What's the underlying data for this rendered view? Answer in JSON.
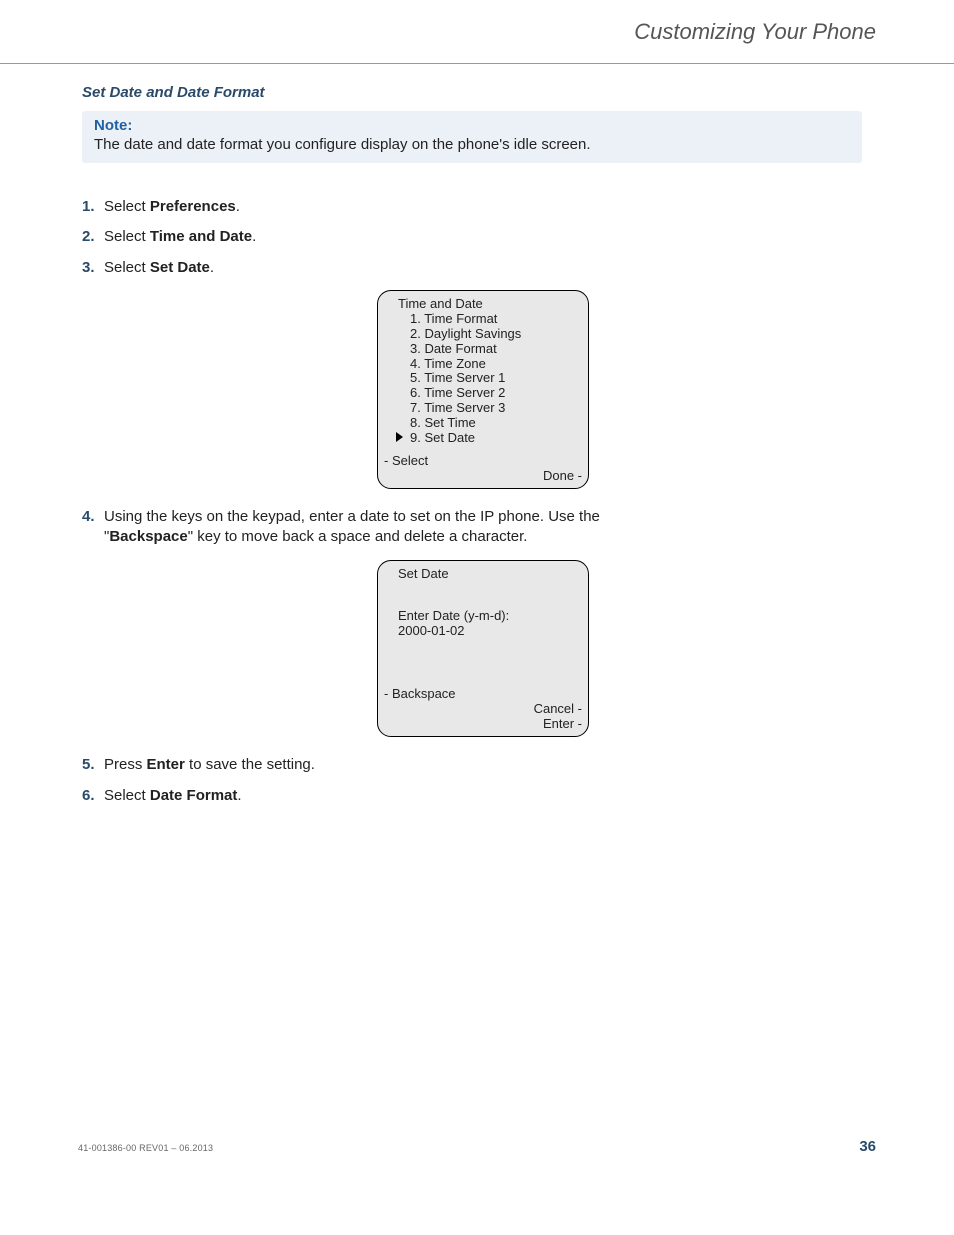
{
  "header": {
    "chapter": "Customizing Your Phone"
  },
  "section": {
    "title": "Set Date and Date Format"
  },
  "note": {
    "label": "Note:",
    "body": "The date and date format you configure display on the phone's idle screen."
  },
  "steps": {
    "s1": {
      "prefix": "Select ",
      "bold": "Preferences",
      "suffix": "."
    },
    "s2": {
      "prefix": "Select ",
      "bold": "Time and Date",
      "suffix": "."
    },
    "s3": {
      "prefix": "Select ",
      "bold": "Set Date",
      "suffix": "."
    },
    "s4": {
      "line1_a": "Using the keys on the keypad, enter a date to set on the IP phone. Use the",
      "line2_a": "\"",
      "line2_bold": "Backspace",
      "line2_b": "\" key to move back a space and delete a character."
    },
    "s5": {
      "prefix": "Press ",
      "bold": "Enter",
      "suffix": " to save the setting."
    },
    "s6": {
      "prefix": "Select ",
      "bold": "Date Format",
      "suffix": "."
    }
  },
  "screen1": {
    "title": "Time and Date",
    "items": {
      "i1": "1. Time Format",
      "i2": "2. Daylight Savings",
      "i3": "3. Date Format",
      "i4": "4. Time Zone",
      "i5": "5. Time Server 1",
      "i6": "6. Time Server 2",
      "i7": "7. Time Server 3",
      "i8": "8. Set Time",
      "i9": "9. Set Date"
    },
    "soft_left": "- Select",
    "soft_right": "Done -"
  },
  "screen2": {
    "title": "Set Date",
    "prompt": "Enter Date (y-m-d):",
    "value": "2000-01-02",
    "soft_left": "- Backspace",
    "soft_right1": "Cancel -",
    "soft_right2": "Enter -"
  },
  "footer": {
    "docid": "41-001386-00 REV01 – 06.2013",
    "page": "36"
  }
}
